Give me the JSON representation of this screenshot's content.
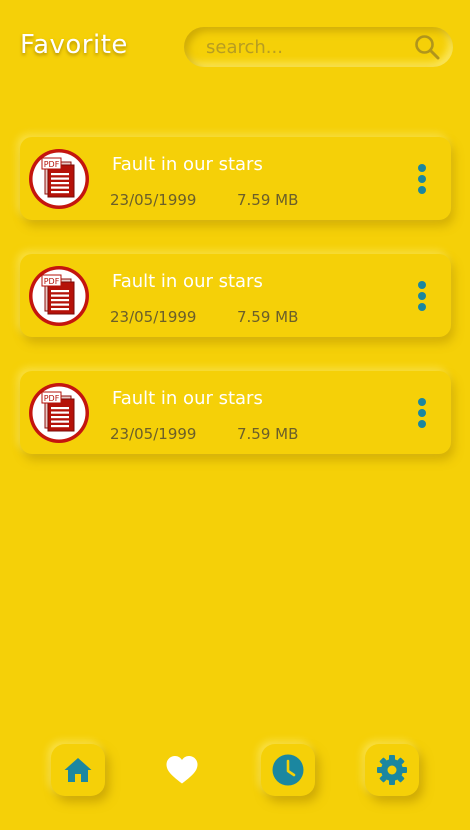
{
  "header": {
    "title": "Favorite"
  },
  "search": {
    "placeholder": "search..."
  },
  "files": [
    {
      "name": "Fault in our stars",
      "date": "23/05/1999",
      "size": "7.59 MB",
      "icon": "pdf-icon"
    },
    {
      "name": "Fault in our stars",
      "date": "23/05/1999",
      "size": "7.59 MB",
      "icon": "pdf-icon"
    },
    {
      "name": "Fault in our stars",
      "date": "23/05/1999",
      "size": "7.59 MB",
      "icon": "pdf-icon"
    }
  ],
  "pdf_badge_text": "PDF",
  "bottom_nav": {
    "items": [
      {
        "id": "home",
        "icon": "home-icon",
        "active": false
      },
      {
        "id": "favorite",
        "icon": "heart-icon",
        "active": true
      },
      {
        "id": "recent",
        "icon": "clock-icon",
        "active": false
      },
      {
        "id": "settings",
        "icon": "gear-icon",
        "active": false
      }
    ]
  },
  "colors": {
    "background": "#f5d008",
    "accent": "#1b87a0",
    "title_text": "#ffffff",
    "meta_text": "#6b5f2a",
    "pdf_red": "#c4150e"
  }
}
